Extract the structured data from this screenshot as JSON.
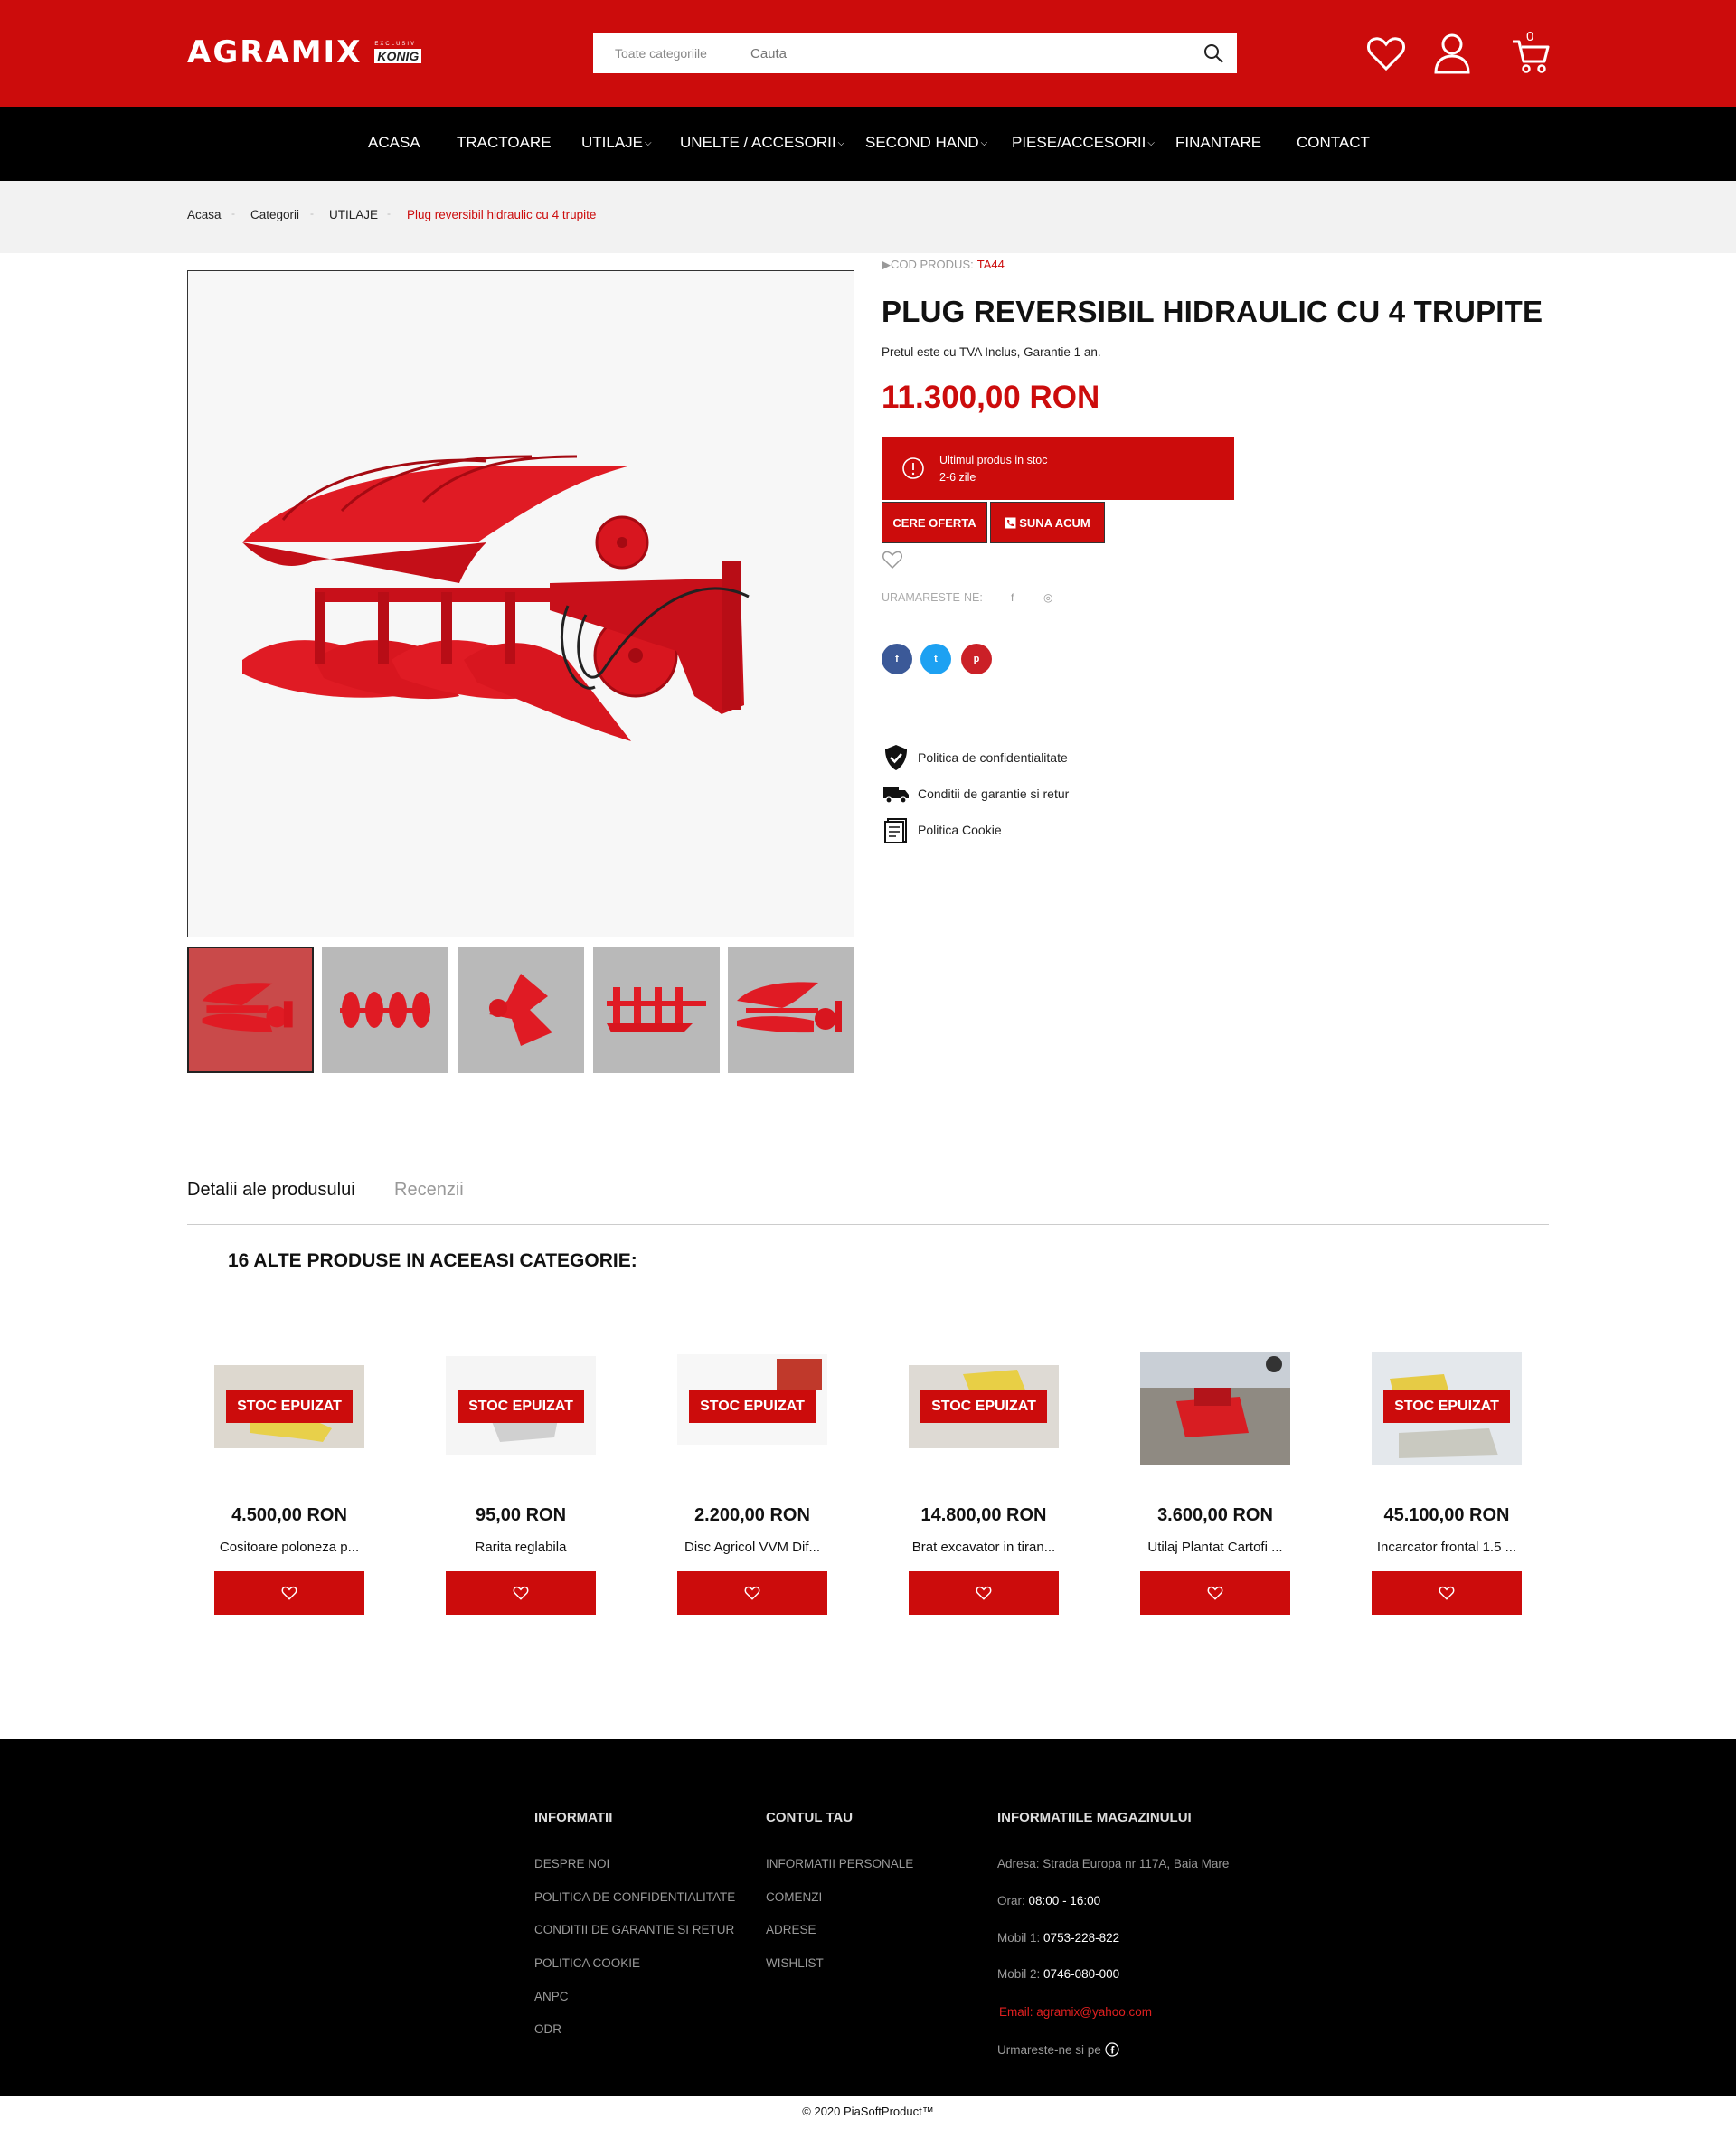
{
  "colors": {
    "brand": "#cc0c0c",
    "nav_bg": "#000000",
    "footer_bg": "#000000",
    "facebook": "#3b5998",
    "twitter": "#1da1f2",
    "pinterest": "#cb2027"
  },
  "header": {
    "logo_text": "AGRAMIX",
    "logo_sub_top": "EXCLUSIV",
    "logo_sub_brand": "KONIG",
    "search_category": "Toate categoriile",
    "search_placeholder": "Cauta",
    "cart_count": "0",
    "icons": [
      "search-icon",
      "heart-icon",
      "user-icon",
      "cart-icon"
    ]
  },
  "nav": {
    "items": [
      {
        "label": "ACASA"
      },
      {
        "label": "TRACTOARE"
      },
      {
        "label": "UTILAJE"
      },
      {
        "label": "UNELTE / ACCESORII"
      },
      {
        "label": "SECOND HAND"
      },
      {
        "label": "PIESE/ACCESORII"
      },
      {
        "label": "FINANTARE"
      },
      {
        "label": "CONTACT"
      }
    ]
  },
  "breadcrumb": [
    "Acasa",
    "Categorii",
    "UTILAJE",
    "Plug reversibil hidraulic cu 4 trupite"
  ],
  "product": {
    "code_label": "▶COD PRODUS:",
    "code_value": "TA44",
    "title": "PLUG REVERSIBIL HIDRAULIC CU 4 TRUPITE",
    "vat_note": "Pretul este cu TVA Inclus, Garantie 1 an.",
    "price": "11.300,00 RON",
    "stock_line1": "Ultimul produs in stoc",
    "stock_line2": "2-6 zile",
    "btn_offer": "CERE OFERTA",
    "btn_call": "SUNA ACUM",
    "follow_label": "URAMARESTE-NE:",
    "follow_fb": "f",
    "follow_ig": "◎",
    "share": [
      "f",
      "t",
      "p"
    ],
    "policies": [
      "Politica de confidentialitate",
      "Conditii de garantie si retur",
      "Politica Cookie"
    ]
  },
  "tabs": {
    "details": "Detalii ale produsului",
    "reviews": "Recenzii"
  },
  "related": {
    "title": "16 ALTE PRODUSE IN ACEEASI CATEGORIE:",
    "badge": "STOC EPUIZAT",
    "items": [
      {
        "price": "4.500,00 RON",
        "name": "Cositoare poloneza p...",
        "out_of_stock": true
      },
      {
        "price": "95,00 RON",
        "name": "Rarita reglabila",
        "out_of_stock": true
      },
      {
        "price": "2.200,00 RON",
        "name": "Disc Agricol VVM Dif...",
        "out_of_stock": true
      },
      {
        "price": "14.800,00 RON",
        "name": "Brat excavator in tiran...",
        "out_of_stock": true
      },
      {
        "price": "3.600,00 RON",
        "name": "Utilaj Plantat Cartofi ...",
        "out_of_stock": false
      },
      {
        "price": "45.100,00 RON",
        "name": "Incarcator frontal 1.5 ...",
        "out_of_stock": true
      }
    ]
  },
  "footer": {
    "col1_title": "INFORMATII",
    "col1_links": [
      "DESPRE NOI",
      "POLITICA DE CONFIDENTIALITATE",
      "CONDITII DE GARANTIE SI RETUR",
      "POLITICA COOKIE",
      "ANPC",
      "ODR"
    ],
    "col2_title": "CONTUL TAU",
    "col2_links": [
      "INFORMATII PERSONALE",
      "COMENZI",
      "ADRESE",
      "WISHLIST"
    ],
    "col3_title": "INFORMATIILE MAGAZINULUI",
    "address": "Adresa: Strada Europa nr 117A, Baia Mare",
    "hours_label": "Orar:",
    "hours_value": "08:00 - 16:00",
    "mobile1_label": "Mobil 1:",
    "mobile1_value": "0753-228-822",
    "mobile2_label": "Mobil 2:",
    "mobile2_value": "0746-080-000",
    "email": "Email: agramix@yahoo.com",
    "follow": "Urmareste-ne si pe",
    "copyright": "© 2020 PiaSoftProduct™"
  }
}
